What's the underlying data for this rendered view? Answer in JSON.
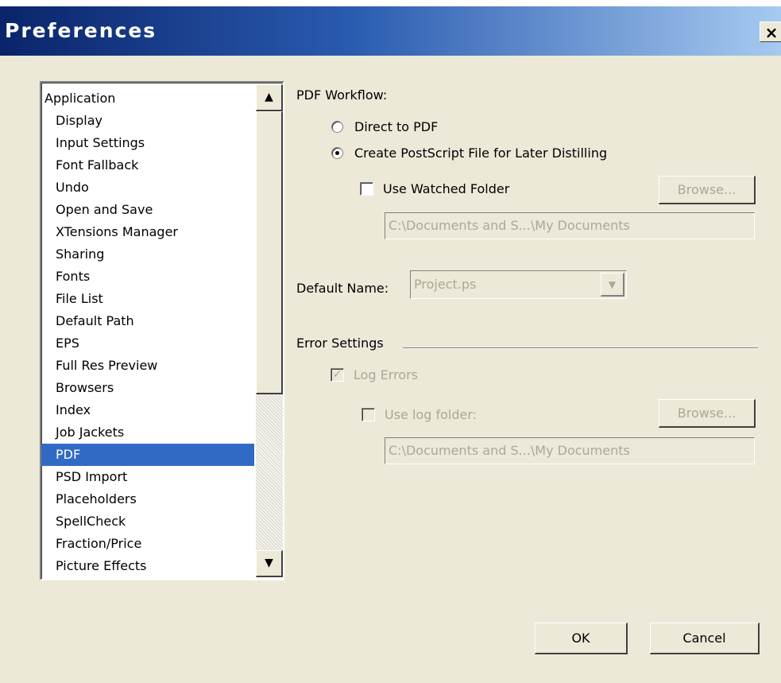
{
  "window": {
    "title": "Preferences",
    "close_glyph": "×"
  },
  "categories": {
    "top": "Application",
    "items": [
      "Display",
      "Input Settings",
      "Font Fallback",
      "Undo",
      "Open and Save",
      "XTensions Manager",
      "Sharing",
      "Fonts",
      "File List",
      "Default Path",
      "EPS",
      "Full Res Preview",
      "Browsers",
      "Index",
      "Job Jackets",
      "PDF",
      "PSD Import",
      "Placeholders",
      "SpellCheck",
      "Fraction/Price",
      "Picture Effects"
    ],
    "selected": "PDF"
  },
  "pdf_workflow": {
    "heading": "PDF Workflow:",
    "direct_label": "Direct to PDF",
    "direct_selected": false,
    "postscript_label": "Create PostScript File for Later Distilling",
    "postscript_selected": true,
    "watched_folder_label": "Use Watched Folder",
    "watched_folder_checked": false,
    "browse_label": "Browse...",
    "path_value": "C:\\Documents and S...\\My Documents"
  },
  "default_name": {
    "label": "Default Name:",
    "value": "Project.ps"
  },
  "error_settings": {
    "heading": "Error Settings",
    "log_errors_label": "Log Errors",
    "log_errors_checked": true,
    "use_log_folder_label": "Use log folder:",
    "use_log_folder_checked": false,
    "browse_label": "Browse...",
    "path_value": "C:\\Documents and S...\\My Documents"
  },
  "buttons": {
    "ok": "OK",
    "cancel": "Cancel"
  },
  "colors": {
    "title_bar": "#0a246a",
    "selection": "#316ac5",
    "dialog_bg": "#ece9d8",
    "disabled_text": "#aca899"
  }
}
